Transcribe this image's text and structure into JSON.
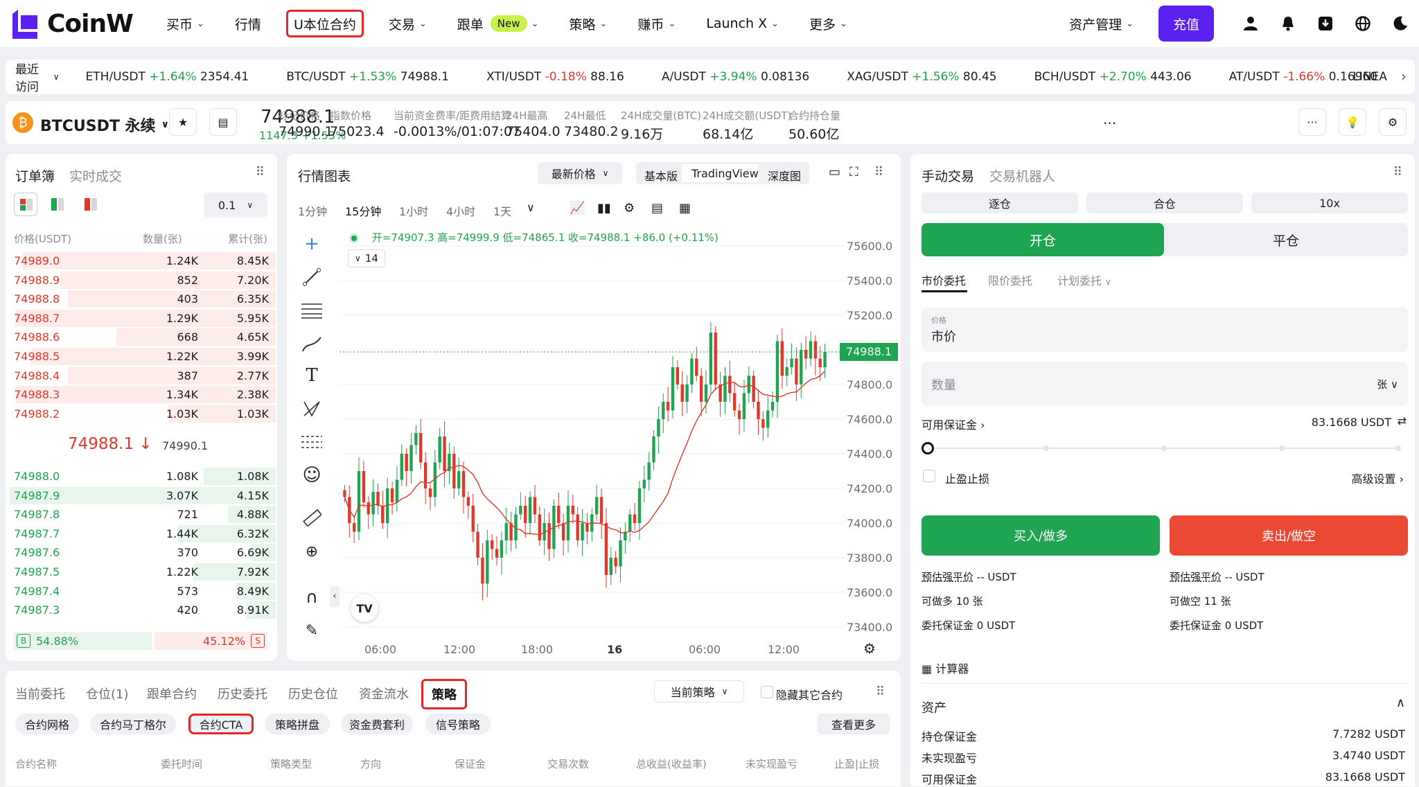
{
  "nav": {
    "brand": "CoinW",
    "items": [
      {
        "label": "买币",
        "chevron": true
      },
      {
        "label": "行情",
        "chevron": false
      },
      {
        "label": "U本位合约",
        "chevron": false,
        "highlight": true
      },
      {
        "label": "交易",
        "chevron": true
      },
      {
        "label": "跟单",
        "chevron": true,
        "badge": "New"
      },
      {
        "label": "策略",
        "chevron": true
      },
      {
        "label": "赚币",
        "chevron": true
      },
      {
        "label": "Launch X",
        "chevron": true
      },
      {
        "label": "更多",
        "chevron": true
      }
    ],
    "assets": "资产管理",
    "deposit": "充值",
    "icons": [
      "user-icon",
      "bell-icon",
      "download-icon",
      "globe-icon",
      "moon-icon"
    ],
    "accent": "#5b21f0"
  },
  "ticker": {
    "recent": "最近访问",
    "items": [
      {
        "pair": "ETH/USDT",
        "change": "+1.64%",
        "price": "2354.41",
        "dir": "up"
      },
      {
        "pair": "BTC/USDT",
        "change": "+1.53%",
        "price": "74988.1",
        "dir": "up"
      },
      {
        "pair": "XTI/USDT",
        "change": "-0.18%",
        "price": "88.16",
        "dir": "down"
      },
      {
        "pair": "A/USDT",
        "change": "+3.94%",
        "price": "0.08136",
        "dir": "up"
      },
      {
        "pair": "XAG/USDT",
        "change": "+1.56%",
        "price": "80.45",
        "dir": "up"
      },
      {
        "pair": "BCH/USDT",
        "change": "+2.70%",
        "price": "443.06",
        "dir": "up"
      },
      {
        "pair": "AT/USDT",
        "change": "-1.66%",
        "price": "0.16960",
        "dir": "down"
      }
    ],
    "overflow": "LINEA"
  },
  "header": {
    "symbol": "BTCUSDT 永续",
    "coin_letter": "₿",
    "last_price": "74988.1",
    "change": "1147.3 +1.53%",
    "stats": [
      {
        "label": "标记价格",
        "value": "74990.1"
      },
      {
        "label": "指数价格",
        "value": "75023.4"
      },
      {
        "label": "当前资金费率/距费用结算",
        "value": "-0.0013%/01:07:07"
      },
      {
        "label": "24H最高",
        "value": "75404.0"
      },
      {
        "label": "24H最低",
        "value": "73480.2"
      },
      {
        "label": "24H成交量(BTC)",
        "value": "9.16万"
      },
      {
        "label": "24H成交额(USDT)",
        "value": "68.14亿"
      },
      {
        "label": "合约持仓量",
        "value": "50.60亿"
      }
    ],
    "more": "..."
  },
  "orderbook": {
    "tab_active": "订单簿",
    "tab_other": "实时成交",
    "precision": "0.1",
    "columns": [
      "价格(USDT)",
      "数量(张)",
      "累计(张)"
    ],
    "asks": [
      {
        "price": "74989.0",
        "qty": "1.24K",
        "total": "8.45K",
        "depth": 0.95
      },
      {
        "price": "74988.9",
        "qty": "852",
        "total": "7.20K",
        "depth": 0.81
      },
      {
        "price": "74988.8",
        "qty": "403",
        "total": "6.35K",
        "depth": 0.78
      },
      {
        "price": "74988.7",
        "qty": "1.29K",
        "total": "5.95K",
        "depth": 0.98
      },
      {
        "price": "74988.6",
        "qty": "668",
        "total": "4.65K",
        "depth": 0.6
      },
      {
        "price": "74988.5",
        "qty": "1.22K",
        "total": "3.99K",
        "depth": 0.92
      },
      {
        "price": "74988.4",
        "qty": "387",
        "total": "2.77K",
        "depth": 0.78
      },
      {
        "price": "74988.3",
        "qty": "1.34K",
        "total": "2.38K",
        "depth": 0.98
      },
      {
        "price": "74988.2",
        "qty": "1.03K",
        "total": "1.03K",
        "depth": 0.4
      }
    ],
    "mid_price": "74988.1",
    "mid_arrow": "↓",
    "mark_price": "74990.1",
    "bids": [
      {
        "price": "74988.0",
        "qty": "1.08K",
        "total": "1.08K",
        "depth": 0.27
      },
      {
        "price": "74987.9",
        "qty": "3.07K",
        "total": "4.15K",
        "depth": 1.0
      },
      {
        "price": "74987.8",
        "qty": "721",
        "total": "4.88K",
        "depth": 0.18
      },
      {
        "price": "74987.7",
        "qty": "1.44K",
        "total": "6.32K",
        "depth": 0.37
      },
      {
        "price": "74987.6",
        "qty": "370",
        "total": "6.69K",
        "depth": 0.09
      },
      {
        "price": "74987.5",
        "qty": "1.22K",
        "total": "7.92K",
        "depth": 0.31
      },
      {
        "price": "74987.4",
        "qty": "573",
        "total": "8.49K",
        "depth": 0.15
      },
      {
        "price": "74987.3",
        "qty": "420",
        "total": "8.91K",
        "depth": 0.11
      }
    ],
    "buy_ratio_label": "B",
    "buy_ratio": "54.88%",
    "sell_ratio": "45.12%",
    "sell_ratio_label": "S"
  },
  "chart": {
    "title": "行情图表",
    "price_type": "最新价格",
    "views": [
      "基本版",
      "TradingView",
      "深度图"
    ],
    "active_view": "TradingView",
    "intervals": [
      "1分钟",
      "15分钟",
      "1小时",
      "4小时",
      "1天"
    ],
    "active_interval": "15分钟",
    "ohlc": "开=74907.3  高=74999.9  低=74865.1  收=74988.1  +86.0 (+0.11%)",
    "ma_period": "14",
    "tv_logo": "TV",
    "last_label": "74988.1"
  },
  "chart_data": {
    "type": "candlestick",
    "ylim": [
      73300,
      75700
    ],
    "yticks": [
      "75600.0",
      "75400.0",
      "75200.0",
      "75000.0",
      "74800.0",
      "74600.0",
      "74400.0",
      "74200.0",
      "74000.0",
      "73800.0",
      "73600.0",
      "73400.0"
    ],
    "xticks": [
      "06:00",
      "12:00",
      "18:00",
      "16",
      "06:00",
      "12:00"
    ],
    "last_price": 74988.1,
    "series": [
      {
        "name": "close",
        "values": [
          74150,
          74000,
          73950,
          74300,
          74120,
          74050,
          74180,
          74100,
          74000,
          74200,
          74120,
          74250,
          74400,
          74300,
          74450,
          74520,
          74350,
          74200,
          74150,
          74350,
          74500,
          74300,
          74400,
          74200,
          74300,
          74150,
          74100,
          73950,
          73800,
          73650,
          73900,
          73850,
          73800,
          73900,
          74000,
          73900,
          74050,
          74100,
          74000,
          74150,
          74050,
          73900,
          74000,
          73850,
          74100,
          74000,
          73900,
          74100,
          74050,
          73900,
          74000,
          73950,
          74050,
          74150,
          74000,
          73700,
          73800,
          73750,
          73900,
          73950,
          74050,
          74000,
          74200,
          74250,
          74350,
          74500,
          74600,
          74700,
          74650,
          74900,
          74800,
          74700,
          74800,
          74950,
          74850,
          74700,
          74800,
          75100,
          74800,
          74700,
          74850,
          74750,
          74650,
          74600,
          74750,
          74850,
          74700,
          74600,
          74550,
          74650,
          74700,
          75050,
          74850,
          74900,
          74950,
          74800,
          75000,
          74950,
          75050,
          74950,
          74900,
          74988
        ]
      }
    ]
  },
  "trade": {
    "tab_active": "手动交易",
    "tab_other": "交易机器人",
    "margin_modes": [
      "逐仓",
      "合仓",
      "10x"
    ],
    "open_label": "开仓",
    "close_label": "平仓",
    "order_types": [
      "市价委托",
      "限价委托",
      "计划委托"
    ],
    "price_label": "价格",
    "price_value": "市价",
    "qty_placeholder": "数量",
    "qty_unit": "张",
    "avail_label": "可用保证金",
    "avail_value": "83.1668 USDT",
    "slider_pct": 0,
    "tpsl_label": "止盈止损",
    "advanced": "高级设置",
    "buy_label": "买入/做多",
    "sell_label": "卖出/做空",
    "buy_info": [
      {
        "k": "预估强平价",
        "v": "-- USDT"
      },
      {
        "k": "可做多",
        "v": "10 张"
      },
      {
        "k": "委托保证金",
        "v": "0 USDT"
      }
    ],
    "sell_info": [
      {
        "k": "预估强平价",
        "v": "-- USDT"
      },
      {
        "k": "可做空",
        "v": "11 张"
      },
      {
        "k": "委托保证金",
        "v": "0 USDT"
      }
    ],
    "calculator": "计算器",
    "assets_title": "资产",
    "assets": [
      {
        "k": "持仓保证金",
        "v": "7.7282 USDT"
      },
      {
        "k": "未实现盈亏",
        "v": "3.4740 USDT"
      },
      {
        "k": "可用保证金",
        "v": "83.1668 USDT"
      }
    ],
    "buy_color": "#1fa451",
    "sell_color": "#ea4a34"
  },
  "bottom": {
    "tabs": [
      "当前委托",
      "仓位(1)",
      "跟单合约",
      "历史委托",
      "历史仓位",
      "资金流水",
      "策略"
    ],
    "active_tab": "策略",
    "filter": "当前策略",
    "hide_label": "隐藏其它合约",
    "subtabs": [
      "合约网格",
      "合约马丁格尔",
      "合约CTA",
      "策略拼盘",
      "资金费套利",
      "信号策略"
    ],
    "active_subtab": "合约CTA",
    "more_btn": "查看更多",
    "columns": [
      "合约名称",
      "委托时间",
      "策略类型",
      "方向",
      "保证金",
      "交易次数",
      "总收益(收益率)",
      "未实现盈亏",
      "止盈|止损"
    ]
  }
}
